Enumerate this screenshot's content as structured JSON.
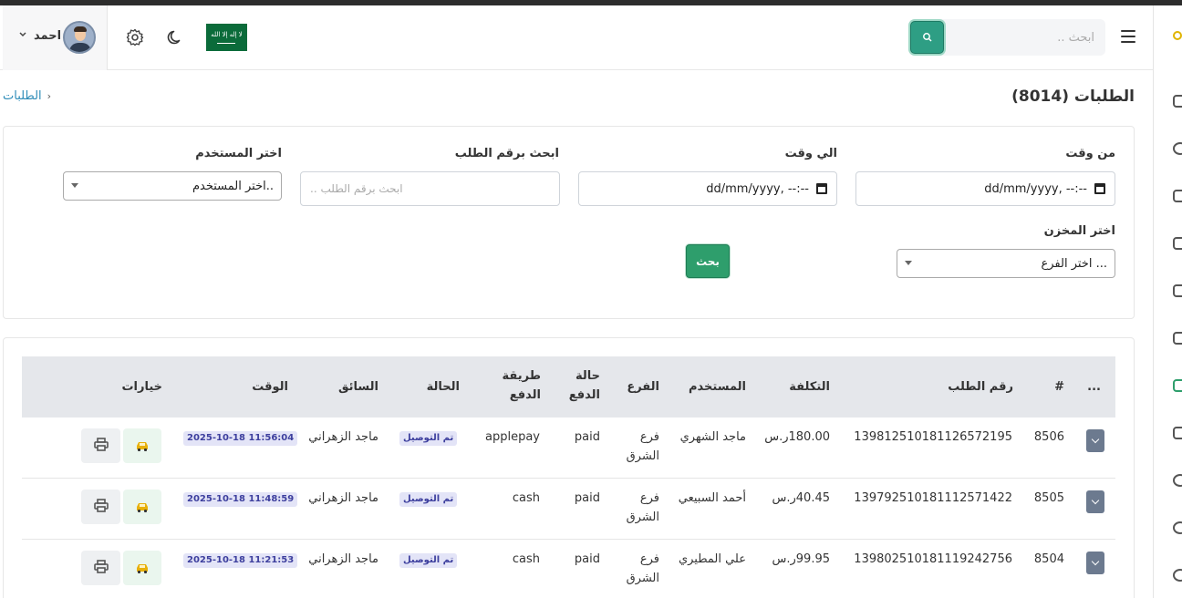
{
  "header": {
    "user_name": "احمد",
    "search_placeholder": "ابحث ..",
    "flag_label": "لا إله إلا الله"
  },
  "page": {
    "title": "الطلبات (8014)",
    "breadcrumb": "الطلبات"
  },
  "filters": {
    "from_label": "من وقت",
    "to_label": "الي وقت",
    "order_label": "ابحث برقم الطلب",
    "user_label": "اختر المستخدم",
    "store_label": "اختر المخزن",
    "date_value": "dd/mm/yyyy, --:--",
    "order_placeholder": "ابحث برقم الطلب ..",
    "user_select": "اختر المستخدم..",
    "branch_select": "اختر الفرع ...",
    "search_button": "بحث"
  },
  "table": {
    "columns": {
      "more": "...",
      "hash": "#",
      "order_no": "رقم الطلب",
      "cost": "التكلفة",
      "user": "المستخدم",
      "branch": "الفرع",
      "pay_status_1": "حالة",
      "pay_status_2": "الدفع",
      "pay_method_1": "طريقة",
      "pay_method_2": "الدفع",
      "status": "الحالة",
      "driver": "السائق",
      "time": "الوقت",
      "options": "خيارات"
    },
    "rows": [
      {
        "id": "8506",
        "order_no": "139812510181126572195",
        "cost": "180.00ر.س",
        "user": "ماجد الشهري",
        "branch_1": "فرع",
        "branch_2": "الشرق",
        "pay_status": "paid",
        "pay_method": "applepay",
        "status": "تم التوصيل",
        "driver": "ماجد الزهراني",
        "time": "2025-10-18 11:56:04"
      },
      {
        "id": "8505",
        "order_no": "139792510181112571422",
        "cost": "40.45ر.س",
        "user": "أحمد السبيعي",
        "branch_1": "فرع",
        "branch_2": "الشرق",
        "pay_status": "paid",
        "pay_method": "cash",
        "status": "تم التوصيل",
        "driver": "ماجد الزهراني",
        "time": "2025-10-18 11:48:59"
      },
      {
        "id": "8504",
        "order_no": "139802510181119242756",
        "cost": "99.95ر.س",
        "user": "علي المطيري",
        "branch_1": "فرع",
        "branch_2": "الشرق",
        "pay_status": "paid",
        "pay_method": "cash",
        "status": "تم التوصيل",
        "driver": "ماجد الزهراني",
        "time": "2025-10-18 11:21:53"
      }
    ]
  },
  "colors": {
    "accent": "#2e9e6c",
    "search_btn": "#2e9e84",
    "badge_bg": "#e3e4f7",
    "badge_text": "#3d3f9e"
  },
  "icons": [
    "search-icon",
    "menu-icon",
    "gear-icon",
    "moon-icon",
    "chevron-down-icon",
    "car-icon",
    "printer-icon"
  ]
}
